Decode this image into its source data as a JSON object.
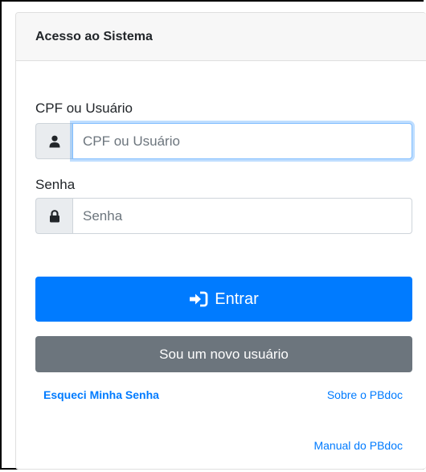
{
  "card": {
    "title": "Acesso ao Sistema"
  },
  "user": {
    "label": "CPF ou Usuário",
    "placeholder": "CPF ou Usuário",
    "value": "",
    "icon": "user-icon"
  },
  "password": {
    "label": "Senha",
    "placeholder": "Senha",
    "value": "",
    "icon": "lock-icon"
  },
  "actions": {
    "login_label": "Entrar",
    "login_icon": "sign-in-icon",
    "new_user_label": "Sou um novo usuário"
  },
  "links": {
    "forgot_password": "Esqueci Minha Senha",
    "about": "Sobre o PBdoc",
    "manual": "Manual do PBdoc"
  },
  "colors": {
    "primary": "#007bff",
    "secondary": "#6c757d",
    "header_bg": "#f7f7f7"
  }
}
